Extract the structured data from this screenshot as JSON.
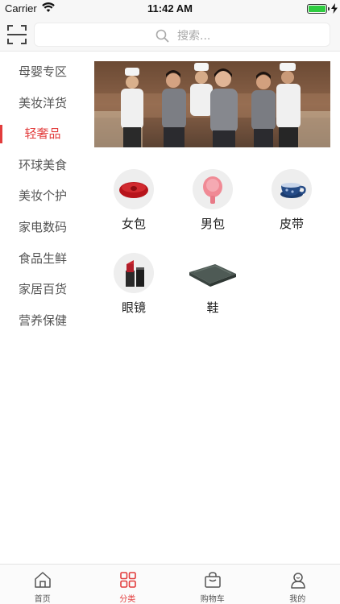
{
  "status_bar": {
    "carrier": "Carrier",
    "time": "11:42 AM",
    "battery_level": 1.0
  },
  "header": {
    "scan_icon": "scan-icon",
    "search_icon": "search-icon",
    "search_placeholder": "搜索..."
  },
  "sidebar": {
    "items": [
      {
        "label": "母婴专区",
        "active": false
      },
      {
        "label": "美妆洋货",
        "active": false
      },
      {
        "label": "轻奢品",
        "active": true
      },
      {
        "label": "环球美食",
        "active": false
      },
      {
        "label": "美妆个护",
        "active": false
      },
      {
        "label": "家电数码",
        "active": false
      },
      {
        "label": "食品生鲜",
        "active": false
      },
      {
        "label": "家居百货",
        "active": false
      },
      {
        "label": "营养保健",
        "active": false
      }
    ]
  },
  "banner": {
    "image": "team-photo-banner"
  },
  "subcategories": [
    {
      "label": "女包",
      "icon": "red-pillow-icon"
    },
    {
      "label": "男包",
      "icon": "pink-brush-icon"
    },
    {
      "label": "皮带",
      "icon": "blue-teapot-icon"
    },
    {
      "label": "眼镜",
      "icon": "lipstick-icon"
    },
    {
      "label": "鞋",
      "icon": "grey-blanket-icon"
    }
  ],
  "tabbar": {
    "tabs": [
      {
        "label": "首页",
        "icon": "home-icon",
        "active": false
      },
      {
        "label": "分类",
        "icon": "category-grid-icon",
        "active": true
      },
      {
        "label": "购物车",
        "icon": "shopping-bag-icon",
        "active": false
      },
      {
        "label": "我的",
        "icon": "profile-icon",
        "active": false
      }
    ]
  },
  "colors": {
    "accent": "#e23c3c",
    "text": "#333333",
    "muted": "#a8a8a8"
  }
}
